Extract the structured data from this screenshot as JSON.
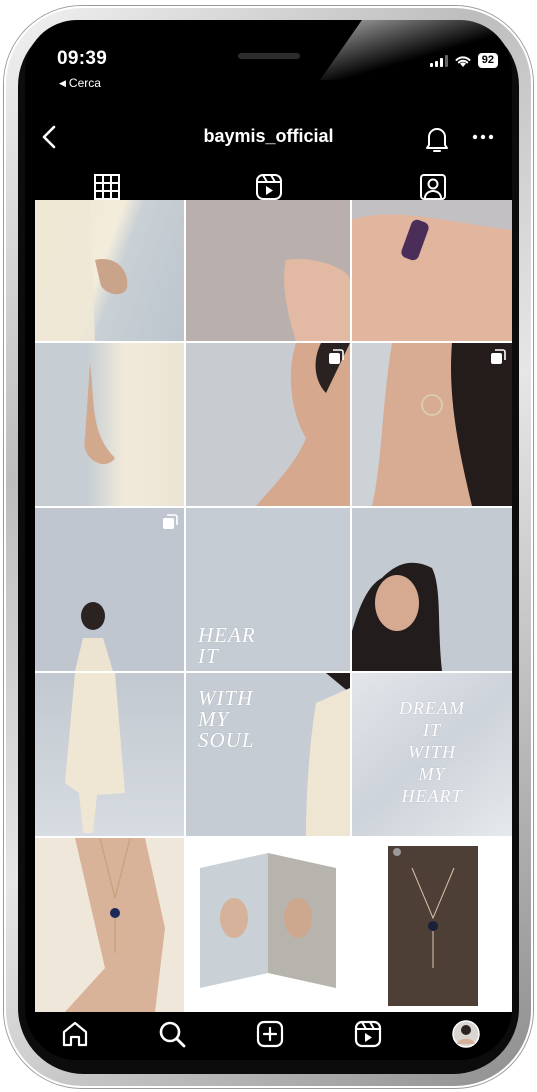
{
  "status_bar": {
    "time": "09:39",
    "back_app": "Cerca",
    "battery": "92"
  },
  "header": {
    "username": "baymis_official"
  },
  "tabs": [
    {
      "name": "posts",
      "icon": "grid-icon"
    },
    {
      "name": "reels",
      "icon": "reels-icon"
    },
    {
      "name": "tagged",
      "icon": "tagged-user-icon"
    }
  ],
  "posts": {
    "hear_it": "HEAR\nIT",
    "with_my_soul": "WITH\nMY\nSOUL",
    "dream_text": "DREAM\nIT\nWITH\nMY\nHEART"
  },
  "bottom_nav": [
    {
      "name": "home",
      "icon": "home-icon"
    },
    {
      "name": "search",
      "icon": "search-icon"
    },
    {
      "name": "create",
      "icon": "plus-square-icon"
    },
    {
      "name": "reels",
      "icon": "reels-icon"
    },
    {
      "name": "profile",
      "icon": "profile-avatar"
    }
  ],
  "colors": {
    "background": "#000000",
    "foreground": "#ffffff"
  }
}
